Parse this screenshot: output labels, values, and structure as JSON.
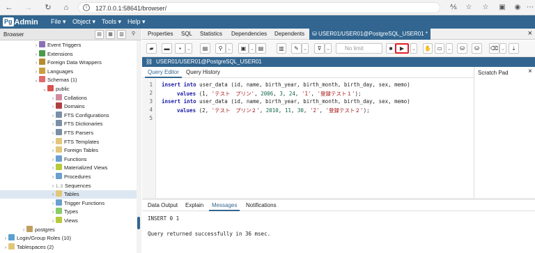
{
  "browser": {
    "url": "127.0.0.1:58641/browser/",
    "url_info": "i"
  },
  "app": {
    "logo_pg": "Pg",
    "logo_admin": "Admin",
    "menus": [
      "File ▾",
      "Object ▾",
      "Tools ▾",
      "Help ▾"
    ]
  },
  "left_panel": {
    "title": "Browser",
    "tree": [
      {
        "label": "Event Triggers",
        "twisty": "›",
        "indent": 1,
        "color": "#8a6fb5"
      },
      {
        "label": "Extensions",
        "twisty": "›",
        "indent": 1,
        "color": "#4a9a4a"
      },
      {
        "label": "Foreign Data Wrappers",
        "twisty": "›",
        "indent": 1,
        "color": "#b88a2e"
      },
      {
        "label": "Languages",
        "twisty": "›",
        "indent": 1,
        "color": "#c8a040"
      },
      {
        "label": "Schemas (1)",
        "twisty": "⌄",
        "indent": 1,
        "color": "#e06b6b"
      },
      {
        "label": "public",
        "twisty": "⌄",
        "indent": 2,
        "color": "#d9534f"
      },
      {
        "label": "Collations",
        "twisty": "›",
        "indent": 3,
        "color": "#d08aa0"
      },
      {
        "label": "Domains",
        "twisty": "›",
        "indent": 3,
        "color": "#b04040"
      },
      {
        "label": "FTS Configurations",
        "twisty": "›",
        "indent": 3,
        "color": "#7a8fa6"
      },
      {
        "label": "FTS Dictionaries",
        "twisty": "›",
        "indent": 3,
        "color": "#7a8fa6"
      },
      {
        "label": "FTS Parsers",
        "twisty": "›",
        "indent": 3,
        "color": "#7a8fa6"
      },
      {
        "label": "FTS Templates",
        "twisty": "›",
        "indent": 3,
        "color": "#e2c67a"
      },
      {
        "label": "Foreign Tables",
        "twisty": "›",
        "indent": 3,
        "color": "#e2c67a"
      },
      {
        "label": "Functions",
        "twisty": "›",
        "indent": 3,
        "color": "#6a9fcf"
      },
      {
        "label": "Materialized Views",
        "twisty": "›",
        "indent": 3,
        "color": "#b8c93a"
      },
      {
        "label": "Procedures",
        "twisty": "›",
        "indent": 3,
        "color": "#6a9fcf"
      },
      {
        "label": "Sequences",
        "twisty": "›",
        "indent": 3,
        "color": "#9a9a9a",
        "prefix": "1..3"
      },
      {
        "label": "Tables",
        "twisty": "›",
        "indent": 3,
        "color": "#e2c67a",
        "selected": true
      },
      {
        "label": "Trigger Functions",
        "twisty": "›",
        "indent": 3,
        "color": "#6a9fcf"
      },
      {
        "label": "Types",
        "twisty": "›",
        "indent": 3,
        "color": "#8acb6a"
      },
      {
        "label": "Views",
        "twisty": "›",
        "indent": 3,
        "color": "#b8c93a"
      },
      {
        "label": "postgres",
        "twisty": "›",
        "indent": 0,
        "color": "#c0a060"
      },
      {
        "label": "Login/Group Roles (10)",
        "twisty": "›",
        "indent": -1,
        "color": "#5aa0d0"
      },
      {
        "label": "Tablespaces (2)",
        "twisty": "›",
        "indent": -1,
        "color": "#e2c67a"
      }
    ]
  },
  "tabs": {
    "items": [
      "Properties",
      "SQL",
      "Statistics",
      "Dependencies",
      "Dependents"
    ],
    "active": "USER01/USER01@PostgreSQL_USER01 *",
    "close": "×"
  },
  "toolbar": {
    "limit": "No limit"
  },
  "connection": {
    "label": "USER01/USER01@PostgreSQL_USER01"
  },
  "editor": {
    "tabs": [
      "Query Editor",
      "Query History"
    ],
    "scratch_title": "Scratch Pad",
    "line_numbers": [
      "1",
      "2",
      "3",
      "4",
      "5"
    ]
  },
  "code_parts": {
    "l1_kw": "insert into",
    "l1_rest": " user_data (id, name, birth_year, birth_month, birth_day, sex, memo)",
    "l2_kw": "values",
    "l2_a": " (1, ",
    "l2_s1": "'テスト　プリン'",
    "l2_b": ", ",
    "l2_n1": "2006",
    "l2_c": ", ",
    "l2_n2": "3",
    "l2_d": ", ",
    "l2_n3": "24",
    "l2_e": ", ",
    "l2_s2": "'1'",
    "l2_f": ", ",
    "l2_s3": "'登録テスト１'",
    "l2_g": ");",
    "l3_kw": "insert into",
    "l3_rest": " user_data (id, name, birth_year, birth_month, birth_day, sex, memo)",
    "l4_kw": "values",
    "l4_a": " (2, ",
    "l4_s1": "'テスト　プリン２'",
    "l4_b": ", ",
    "l4_n1": "2010",
    "l4_c": ", ",
    "l4_n2": "11",
    "l4_d": ", ",
    "l4_n3": "30",
    "l4_e": ", ",
    "l4_s2": "'2'",
    "l4_f": ", ",
    "l4_s3": "'登録テスト２'",
    "l4_g": ");"
  },
  "output": {
    "tabs": [
      "Data Output",
      "Explain",
      "Messages",
      "Notifications"
    ],
    "active": "Messages",
    "line1": "INSERT 0 1",
    "line2": "Query returned successfully in 36 msec."
  }
}
